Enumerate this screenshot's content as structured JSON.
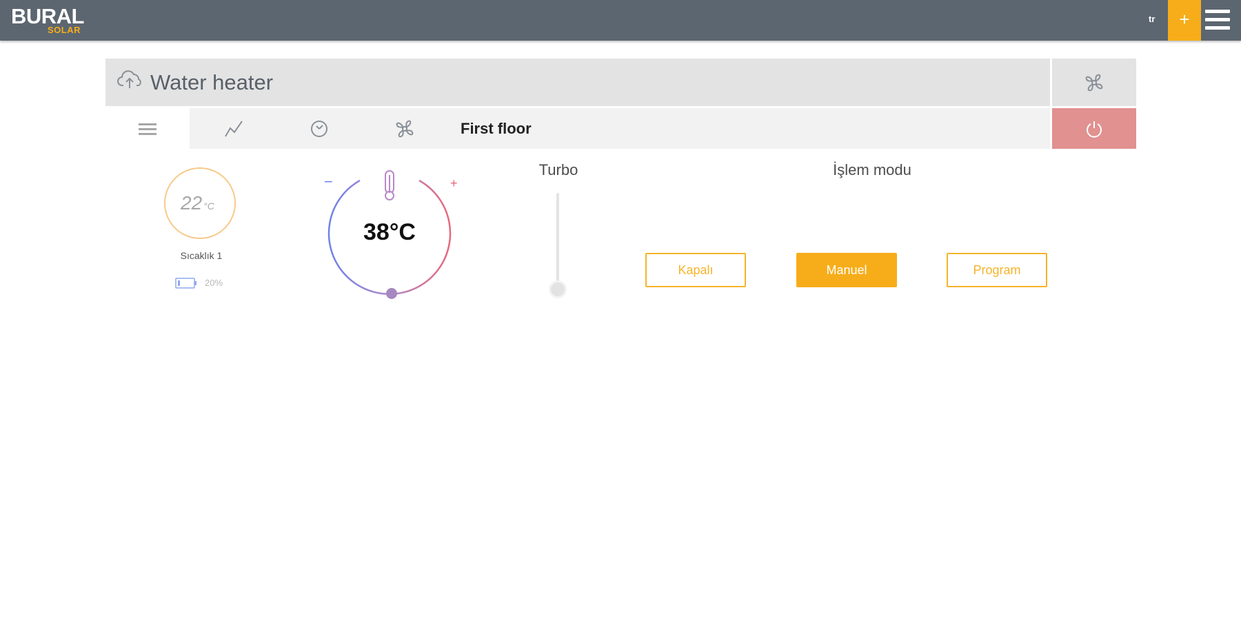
{
  "brand": {
    "name": "BURAL",
    "sub": "SOLAR"
  },
  "topbar": {
    "language": "tr",
    "add_label": "+"
  },
  "card": {
    "title": "Water heater",
    "location": "First floor"
  },
  "tabs": [
    {
      "icon": "list-icon",
      "active": true
    },
    {
      "icon": "chart-icon",
      "active": false
    },
    {
      "icon": "clock-icon",
      "active": false
    },
    {
      "icon": "fan-icon",
      "active": false
    }
  ],
  "sensor": {
    "value": "22",
    "unit": "°C",
    "name": "Sıcaklık 1",
    "battery": "20%"
  },
  "setpoint": {
    "value": "38°C",
    "minus": "−",
    "plus": "+"
  },
  "turbo": {
    "label": "Turbo"
  },
  "mode": {
    "label": "İşlem modu",
    "options": [
      "Kapalı",
      "Manuel",
      "Program"
    ],
    "selected": "Manuel"
  },
  "colors": {
    "topbar": "#5c6670",
    "accent": "#f6ad19",
    "power": "#e09190",
    "header": "#e3e3e3"
  }
}
